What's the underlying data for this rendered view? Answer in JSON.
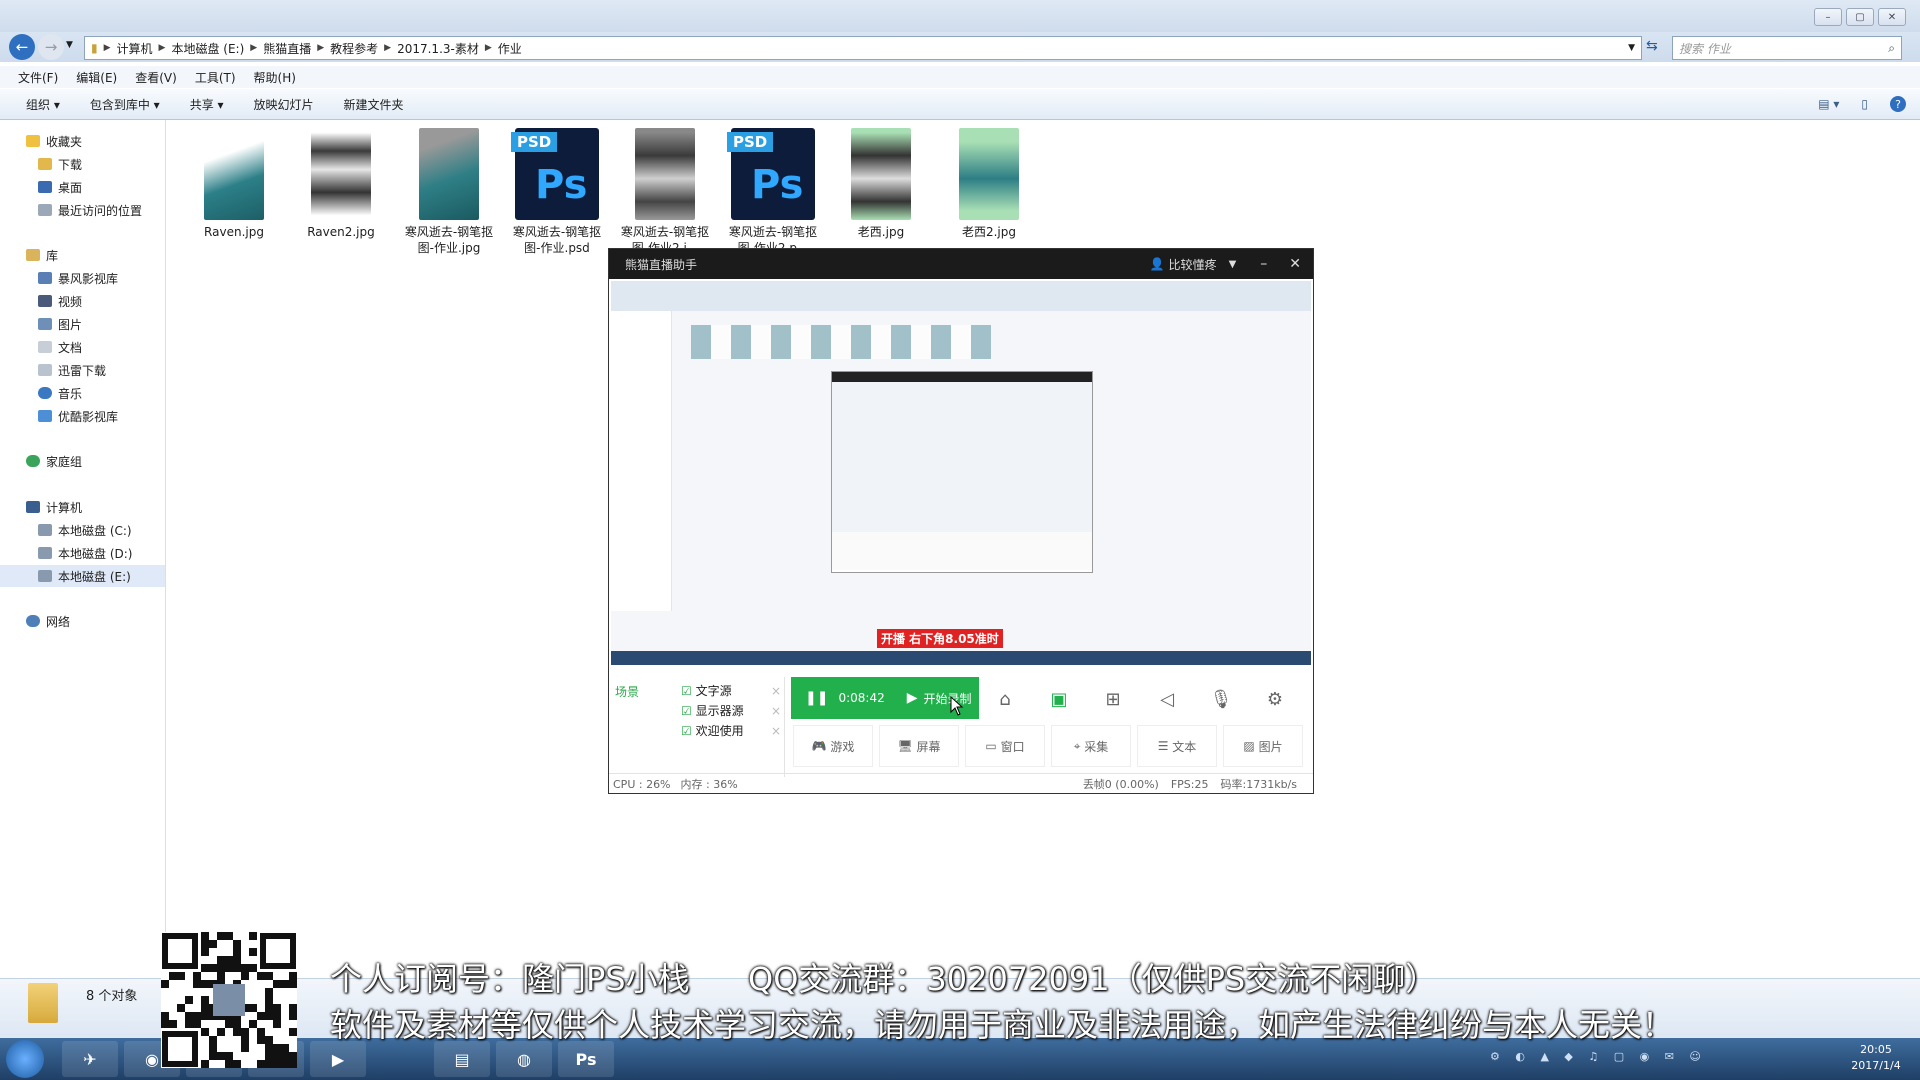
{
  "window": {
    "title": "作业"
  },
  "address": {
    "path": [
      "计算机",
      "本地磁盘 (E:)",
      "熊猫直播",
      "教程参考",
      "2017.1.3-素材",
      "作业"
    ],
    "search_placeholder": "搜索 作业"
  },
  "menu": [
    "文件(F)",
    "编辑(E)",
    "查看(V)",
    "工具(T)",
    "帮助(H)"
  ],
  "toolbar": [
    "组织 ▾",
    "包含到库中 ▾",
    "共享 ▾",
    "放映幻灯片",
    "新建文件夹"
  ],
  "nav": {
    "favorites": "收藏夹",
    "fav_items": [
      "下载",
      "桌面",
      "最近访问的位置"
    ],
    "libraries": "库",
    "lib_items": [
      "暴风影视库",
      "视频",
      "图片",
      "文档",
      "迅雷下载",
      "音乐",
      "优酷影视库"
    ],
    "homegroup": "家庭组",
    "computer": "计算机",
    "drives": [
      "本地磁盘 (C:)",
      "本地磁盘 (D:)",
      "本地磁盘 (E:)"
    ],
    "network": "网络"
  },
  "files": [
    {
      "name": "Raven.jpg",
      "kind": "photo"
    },
    {
      "name": "Raven2.jpg",
      "kind": "photo"
    },
    {
      "name": "寒风逝去-钢笔抠图-作业.jpg",
      "kind": "photo"
    },
    {
      "name": "寒风逝去-钢笔抠图-作业.psd",
      "kind": "psd"
    },
    {
      "name": "寒风逝去-钢笔抠图-作业2.j...",
      "kind": "photo"
    },
    {
      "name": "寒风逝去-钢笔抠图-作业2.p...",
      "kind": "psd"
    },
    {
      "name": "老西.jpg",
      "kind": "photo"
    },
    {
      "name": "老西2.jpg",
      "kind": "photo"
    }
  ],
  "status": {
    "count": "8 个对象"
  },
  "stream": {
    "title": "熊猫直播助手",
    "user": "比较懂疼",
    "preview_banner": "开播 右下角8.05准时",
    "scene_label": "场景",
    "sources": [
      "文字源",
      "显示器源",
      "欢迎使用"
    ],
    "timer": "0:08:42",
    "record_label": "开始录制",
    "source_buttons": [
      "游戏",
      "屏幕",
      "窗口",
      "采集",
      "文本",
      "图片"
    ],
    "cpu": "CPU : 26%",
    "mem": "内存 : 36%",
    "drop": "丢帧0 (0.00%)",
    "fps": "FPS:25",
    "bitrate": "码率:1731kb/s"
  },
  "overlay": {
    "line1": "个人订阅号：隆门PS小栈",
    "line1b": "QQ交流群：302072091（仅供PS交流不闲聊）",
    "line2": "软件及素材等仅供个人技术学习交流，请勿用于商业及非法用途，如产生法律纠纷与本人无关！"
  },
  "clock": {
    "time": "20:05",
    "date": "2017/1/4"
  }
}
